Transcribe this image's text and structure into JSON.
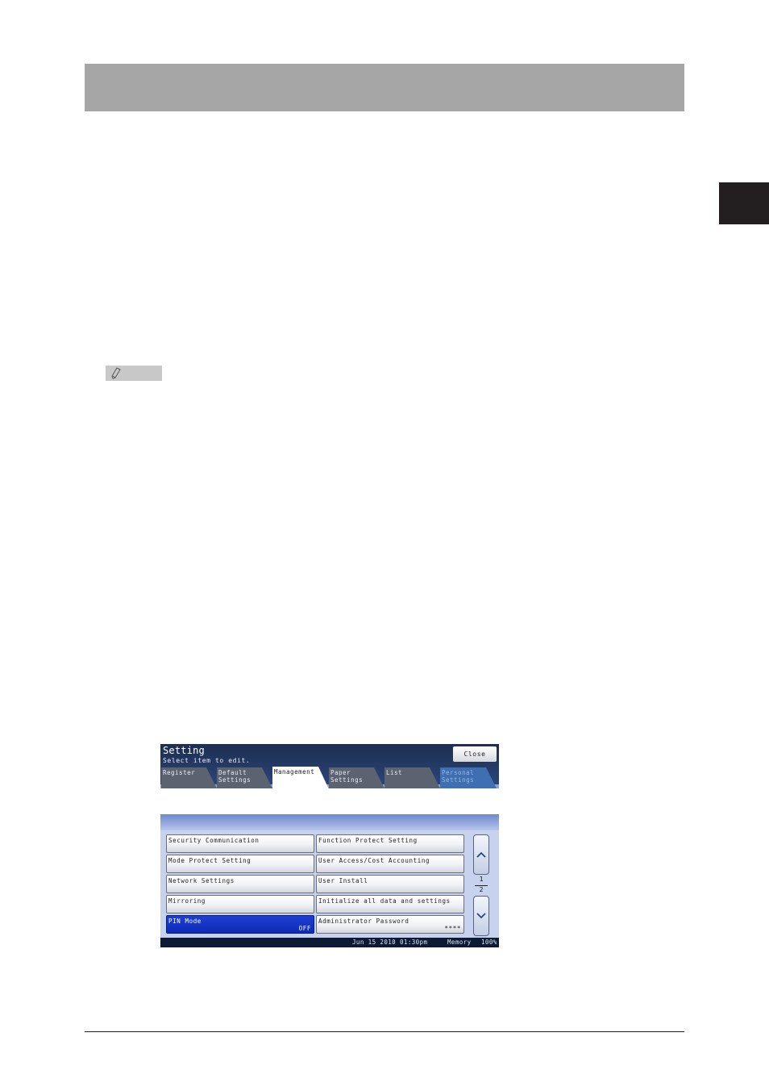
{
  "screen": {
    "title": "Setting",
    "subtitle": "Select item to edit.",
    "close_label": "Close",
    "tabs": [
      {
        "line1": "Register",
        "line2": ""
      },
      {
        "line1": "Default",
        "line2": "Settings"
      },
      {
        "line1": "Management",
        "line2": ""
      },
      {
        "line1": "Paper",
        "line2": "Settings"
      },
      {
        "line1": "List",
        "line2": ""
      },
      {
        "line1": "Personal",
        "line2": "Settings"
      }
    ],
    "active_tab": "Management",
    "buttons_left": [
      {
        "label": "Security Communication",
        "value": ""
      },
      {
        "label": "Mode Protect Setting",
        "value": ""
      },
      {
        "label": "Network Settings",
        "value": ""
      },
      {
        "label": "Mirroring",
        "value": ""
      },
      {
        "label": "PIN Mode",
        "value": "OFF"
      }
    ],
    "buttons_right": [
      {
        "label": "Function Protect Setting",
        "value": ""
      },
      {
        "label": "User Access/Cost Accounting",
        "value": ""
      },
      {
        "label": "User Install",
        "value": ""
      },
      {
        "label": "Initialize all data and settings",
        "value": ""
      },
      {
        "label": "Administrator Password",
        "value": "****"
      }
    ],
    "page": {
      "current": "1",
      "total": "2"
    },
    "status": {
      "datetime": "Jun 15 2010 01:30pm",
      "memory_label": "Memory",
      "memory_value": "100%"
    },
    "colors": {
      "selected_button": "#1d3fd6",
      "titlebar": "#1d2e4f"
    },
    "icons": {
      "scroll_up": "chevron-up-icon",
      "scroll_down": "chevron-down-icon",
      "note": "pencil-icon"
    }
  }
}
